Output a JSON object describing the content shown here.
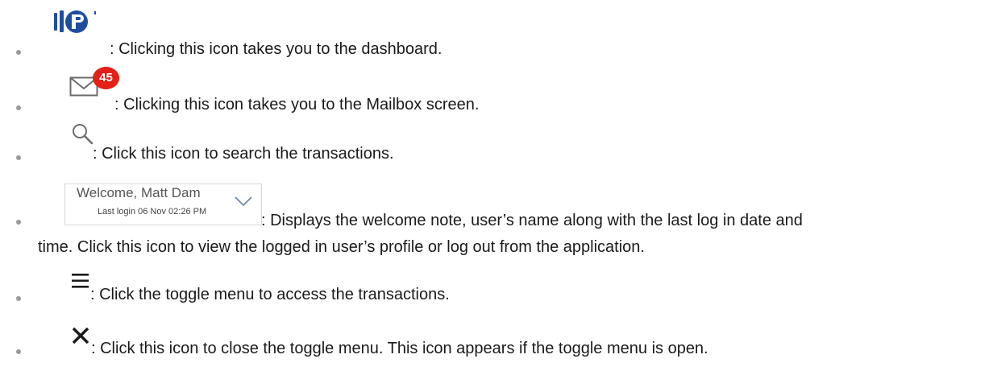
{
  "items": [
    {
      "icon": "company-logo-icon",
      "text": ": Clicking this icon takes you to the dashboard."
    },
    {
      "icon": "mail-icon",
      "badge": "45",
      "badge_color": "#e32119",
      "text": ": Clicking this icon takes you to the Mailbox screen."
    },
    {
      "icon": "search-icon",
      "text": ": Click this icon to search the transactions."
    },
    {
      "icon": "user-menu-icon",
      "welcome": "Welcome, Matt Dam",
      "last_login": "Last login 06 Nov 02:26 PM",
      "text": ":  Displays the welcome note, user’s name along with the last log in date and",
      "text_cont": "time. Click this icon to view the logged in user’s profile or log out from the application."
    },
    {
      "icon": "hamburger-menu-icon",
      "text": ": Click the toggle menu to access the transactions."
    },
    {
      "icon": "close-icon",
      "text": ": Click this icon to close the toggle menu. This icon appears if the toggle menu is open."
    }
  ],
  "colors": {
    "logo_blue": "#1f4e9c",
    "badge_red": "#e32119",
    "icon_gray": "#6b6b6b"
  }
}
